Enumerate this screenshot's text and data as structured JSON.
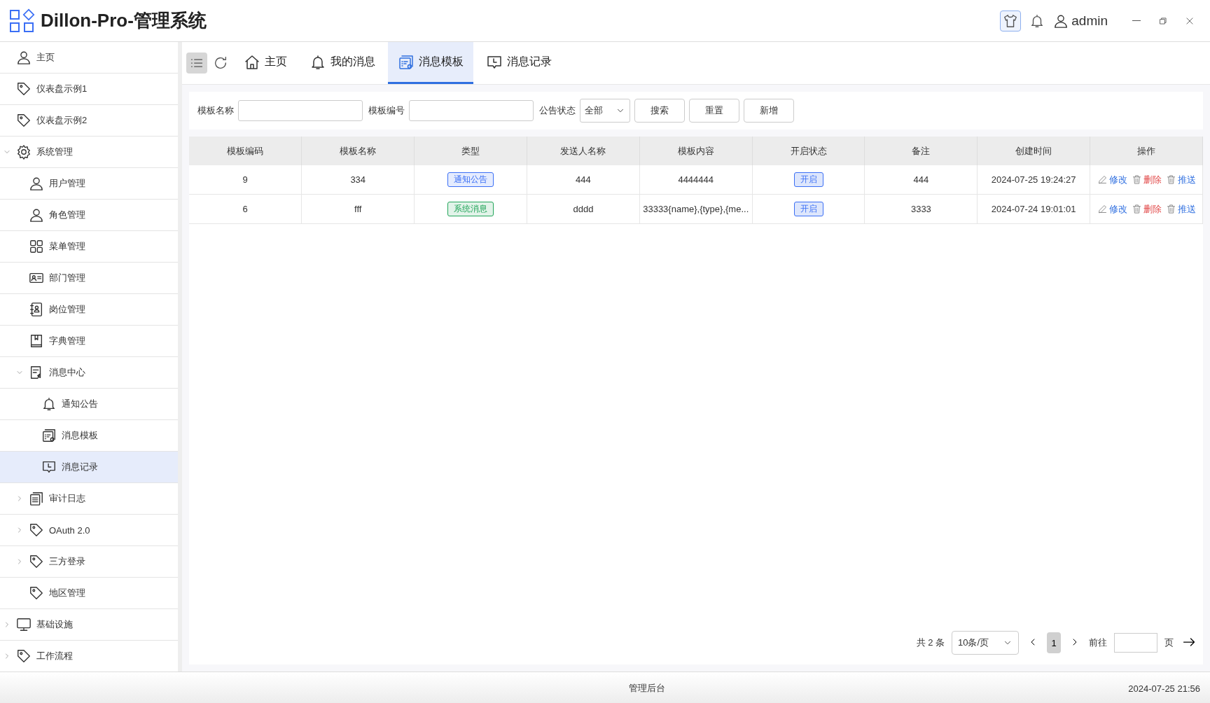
{
  "app": {
    "title": "Dillon-Pro-管理系统",
    "user": "admin"
  },
  "sidebar": {
    "items": [
      {
        "label": "主页",
        "selected": false
      },
      {
        "label": "仪表盘示例1",
        "selected": false
      },
      {
        "label": "仪表盘示例2",
        "selected": false
      },
      {
        "label": "系统管理",
        "selected": false,
        "expanded": true,
        "children": [
          {
            "label": "用户管理",
            "selected": false
          },
          {
            "label": "角色管理",
            "selected": false
          },
          {
            "label": "菜单管理",
            "selected": false
          },
          {
            "label": "部门管理",
            "selected": false
          },
          {
            "label": "岗位管理",
            "selected": false
          },
          {
            "label": "字典管理",
            "selected": false
          },
          {
            "label": "消息中心",
            "selected": false,
            "expanded": true,
            "children": [
              {
                "label": "通知公告",
                "selected": false
              },
              {
                "label": "消息模板",
                "selected": false
              },
              {
                "label": "消息记录",
                "selected": true
              }
            ]
          },
          {
            "label": "审计日志",
            "selected": false,
            "expanded": false
          },
          {
            "label": "OAuth 2.0",
            "selected": false,
            "expanded": false
          },
          {
            "label": "三方登录",
            "selected": false,
            "expanded": false
          },
          {
            "label": "地区管理",
            "selected": false
          }
        ]
      },
      {
        "label": "基础设施",
        "selected": false,
        "expanded": false
      },
      {
        "label": "工作流程",
        "selected": false,
        "expanded": false
      }
    ]
  },
  "tabs": [
    {
      "label": "主页",
      "selected": false
    },
    {
      "label": "我的消息",
      "selected": false
    },
    {
      "label": "消息模板",
      "selected": true
    },
    {
      "label": "消息记录",
      "selected": false
    }
  ],
  "filters": [
    {
      "label": "模板名称",
      "kind": "input"
    },
    {
      "label": "模板编号",
      "kind": "input"
    },
    {
      "label": "公告状态",
      "kind": "select",
      "value": "全部"
    }
  ],
  "filter_buttons": [
    "搜索",
    "重置",
    "新增"
  ],
  "table": {
    "columns": [
      "模板编码",
      "模板名称",
      "类型",
      "发送人名称",
      "模板内容",
      "开启状态",
      "备注",
      "创建时间",
      "操作"
    ],
    "rows": [
      {
        "code": "9",
        "name": "334",
        "type": {
          "text": "通知公告",
          "color": "#3b6ff5"
        },
        "sender": "444",
        "content": "4444444",
        "status": "开启",
        "remark": "444",
        "created": "2024-07-25 19:24:27",
        "actions": [
          "修改",
          "删除",
          "推送"
        ]
      },
      {
        "code": "6",
        "name": "fff",
        "type": {
          "text": "系统消息",
          "color": "#23a55a"
        },
        "sender": "dddd",
        "content": "33333{name},{type},{me...",
        "status": "开启",
        "remark": "3333",
        "created": "2024-07-24 19:01:01",
        "actions": [
          "修改",
          "删除",
          "推送"
        ]
      }
    ]
  },
  "pagination": {
    "total": "共 2 条",
    "page_size": "10条/页",
    "pages": [
      {
        "label": "1",
        "selected": true
      }
    ],
    "goto_label": "前往",
    "goto_suffix": "页"
  },
  "footer": {
    "center": "管理后台",
    "time": "2024-07-25 21:56"
  }
}
